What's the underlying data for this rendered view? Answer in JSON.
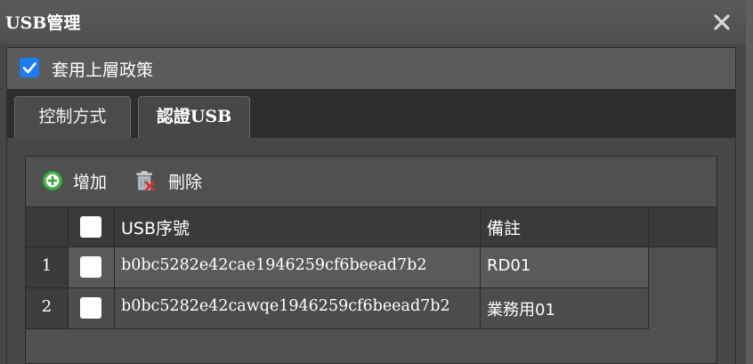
{
  "window": {
    "title": "USB管理",
    "close_icon": "close-icon"
  },
  "inherit_policy": {
    "checked": true,
    "label": "套用上層政策"
  },
  "tabs": [
    {
      "label": "控制方式",
      "active": false
    },
    {
      "label": "認證USB",
      "active": true
    }
  ],
  "toolbar": {
    "add_label": "增加",
    "add_icon": "add-circle-icon",
    "delete_label": "刪除",
    "delete_icon": "trash-delete-icon"
  },
  "table": {
    "columns": [
      "USB序號",
      "備註"
    ],
    "rows": [
      {
        "num": "1",
        "serial": "b0bc5282e42cae1946259cf6beead7b2",
        "note": "RD01",
        "checked": false
      },
      {
        "num": "2",
        "serial": "b0bc5282e42cawqe1946259cf6beead7b2",
        "note": "業務用01",
        "checked": false
      }
    ]
  },
  "colors": {
    "checkbox_accent": "#1e7cf2",
    "add_icon_green": "#4caf50",
    "delete_icon_red": "#d9302c"
  }
}
